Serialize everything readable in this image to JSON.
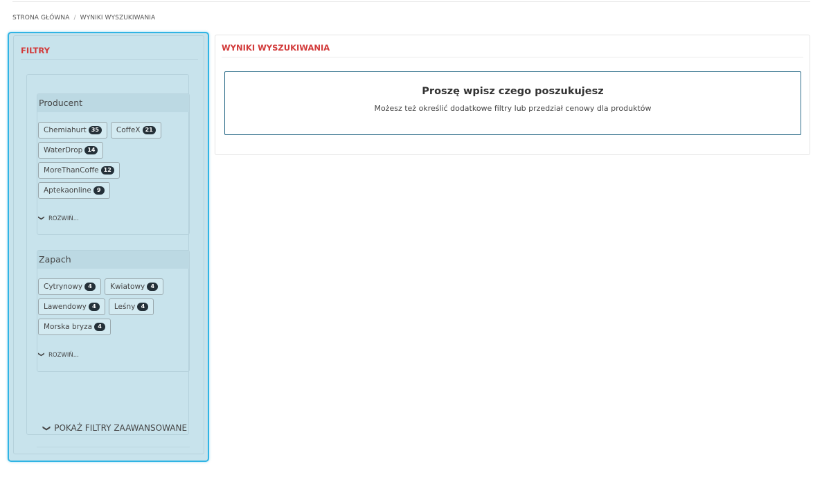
{
  "breadcrumb": {
    "home": "STRONA GŁÓWNA",
    "separator": "/",
    "current": "WYNIKI WYSZUKIWANIA"
  },
  "filters": {
    "title": "FILTRY",
    "groups": [
      {
        "title": "Producent",
        "items": [
          {
            "label": "Chemiahurt",
            "count": "35"
          },
          {
            "label": "CoffeX",
            "count": "21"
          },
          {
            "label": "WaterDrop",
            "count": "14"
          },
          {
            "label": "MoreThanCoffe",
            "count": "12"
          },
          {
            "label": "Aptekaonline",
            "count": "9"
          }
        ],
        "expand_label": "ROZWIŃ..."
      },
      {
        "title": "Zapach",
        "items": [
          {
            "label": "Cytrynowy",
            "count": "4"
          },
          {
            "label": "Kwiatowy",
            "count": "4"
          },
          {
            "label": "Lawendowy",
            "count": "4"
          },
          {
            "label": "Leśny",
            "count": "4"
          },
          {
            "label": "Morska bryza",
            "count": "4"
          }
        ],
        "expand_label": "ROZWIŃ..."
      }
    ],
    "advanced_label": "POKAŻ FILTRY ZAAWANSOWANE",
    "chevron_icon": "chevron-down-icon"
  },
  "results": {
    "title": "WYNIKI WYSZUKIWANIA",
    "notice_heading": "Proszę wpisz czego poszukujesz",
    "notice_text": "Możesz też określić dodatkowe filtry lub przedział cenowy dla produktów"
  },
  "colors": {
    "accent_red": "#d23a3a",
    "panel_focus_border": "#30b4e4",
    "panel_bg": "#c8e3ec",
    "badge_bg": "#243038",
    "notice_border": "#2a6b88"
  }
}
